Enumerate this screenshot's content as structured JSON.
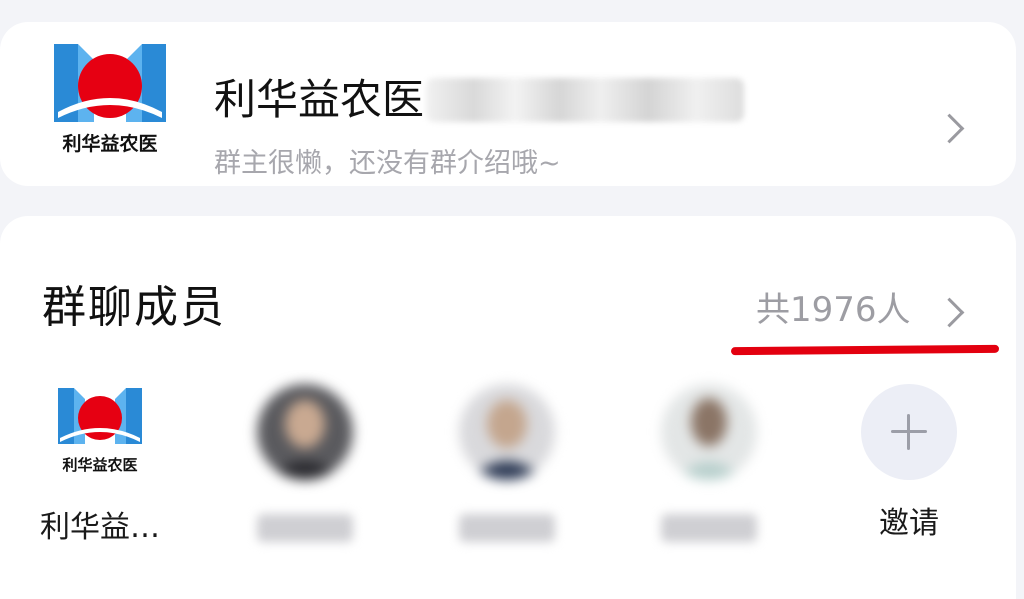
{
  "group": {
    "name": "利华益农医",
    "intro": "群主很懒，还没有群介绍哦~",
    "logo_text": "利华益农医"
  },
  "members_section": {
    "title": "群聊成员",
    "count_label": "共1976人"
  },
  "members": [
    {
      "name": "利华益…",
      "avatar": "company-logo",
      "blurred": false
    },
    {
      "name": "",
      "avatar": "person-photo",
      "blurred": true
    },
    {
      "name": "",
      "avatar": "person-photo",
      "blurred": true
    },
    {
      "name": "",
      "avatar": "person-photo",
      "blurred": true
    }
  ],
  "invite": {
    "label": "邀请",
    "icon": "plus-icon"
  },
  "colors": {
    "background": "#f3f4f8",
    "card": "#ffffff",
    "highlight_underline": "#e3000f",
    "logo_blue": "#2a8ad6",
    "logo_red": "#e60012",
    "secondary_text": "#a7a7ad"
  }
}
